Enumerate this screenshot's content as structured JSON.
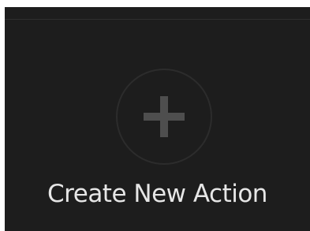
{
  "action_tile": {
    "label": "Create New Action",
    "icon": "plus-icon"
  },
  "colors": {
    "background": "#1d1d1d",
    "icon": "#4e4e4e",
    "circle_border": "#2c2c2c",
    "label_text": "#e6e6e6"
  }
}
